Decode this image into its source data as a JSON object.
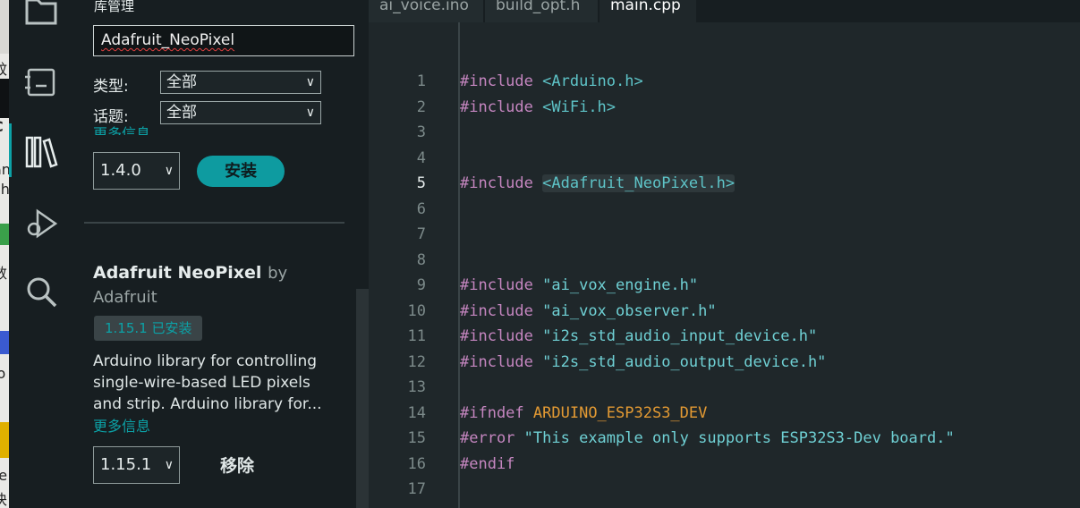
{
  "desktop_fragments": [
    "蚊",
    "C",
    "an",
    "ch",
    "数",
    "lo",
    "re",
    "块"
  ],
  "activity_bar": [
    "folder-icon",
    "board-icon",
    "library-icon",
    "debug-icon",
    "search-icon"
  ],
  "library": {
    "title": "库管理",
    "search_value": "Adafruit_NeoPixel",
    "type_label": "类型:",
    "type_value": "全部",
    "topic_label": "话题:",
    "topic_value": "全部",
    "more_info_top": "更多信息",
    "first_version": "1.4.0",
    "install_label": "安装",
    "item": {
      "name": "Adafruit NeoPixel",
      "by": "by",
      "author": "Adafruit",
      "installed": "1.15.1 已安装",
      "description": "Arduino library for controlling single-wire-based LED pixels and strip. Arduino library for...",
      "more_info": "更多信息",
      "version": "1.15.1",
      "remove_label": "移除"
    }
  },
  "editor": {
    "tabs": [
      "ai_voice.ino",
      "build_opt.h",
      "main.cpp"
    ],
    "active_tab": "main.cpp",
    "current_line": 5,
    "lines": [
      {
        "n": "1",
        "kw": "#include",
        "arg": "<Arduino.h>",
        "t": "hdr"
      },
      {
        "n": "2",
        "kw": "#include",
        "arg": "<WiFi.h>",
        "t": "hdr"
      },
      {
        "n": "3",
        "kw": "",
        "arg": "",
        "t": ""
      },
      {
        "n": "4",
        "kw": "",
        "arg": "",
        "t": ""
      },
      {
        "n": "5",
        "kw": "#include",
        "arg": "<Adafruit_NeoPixel.h>",
        "t": "hdr"
      },
      {
        "n": "6",
        "kw": "",
        "arg": "",
        "t": ""
      },
      {
        "n": "7",
        "kw": "",
        "arg": "",
        "t": ""
      },
      {
        "n": "8",
        "kw": "",
        "arg": "",
        "t": ""
      },
      {
        "n": "9",
        "kw": "#include",
        "arg": "\"ai_vox_engine.h\"",
        "t": "str"
      },
      {
        "n": "10",
        "kw": "#include",
        "arg": "\"ai_vox_observer.h\"",
        "t": "str"
      },
      {
        "n": "11",
        "kw": "#include",
        "arg": "\"i2s_std_audio_input_device.h\"",
        "t": "str"
      },
      {
        "n": "12",
        "kw": "#include",
        "arg": "\"i2s_std_audio_output_device.h\"",
        "t": "str"
      },
      {
        "n": "13",
        "kw": "",
        "arg": "",
        "t": ""
      },
      {
        "n": "14",
        "kw": "#ifndef",
        "arg": "ARDUINO_ESP32S3_DEV",
        "t": "mac"
      },
      {
        "n": "15",
        "kw": "#error",
        "arg": "\"This example only supports ESP32S3-Dev board.\"",
        "t": "str"
      },
      {
        "n": "16",
        "kw": "#endif",
        "arg": "",
        "t": ""
      },
      {
        "n": "17",
        "kw": "",
        "arg": "",
        "t": ""
      }
    ]
  },
  "colors": {
    "accent": "#0ca1a6",
    "keyword": "#c586c0",
    "string": "#6fd0d4",
    "macro": "#e39a33"
  }
}
